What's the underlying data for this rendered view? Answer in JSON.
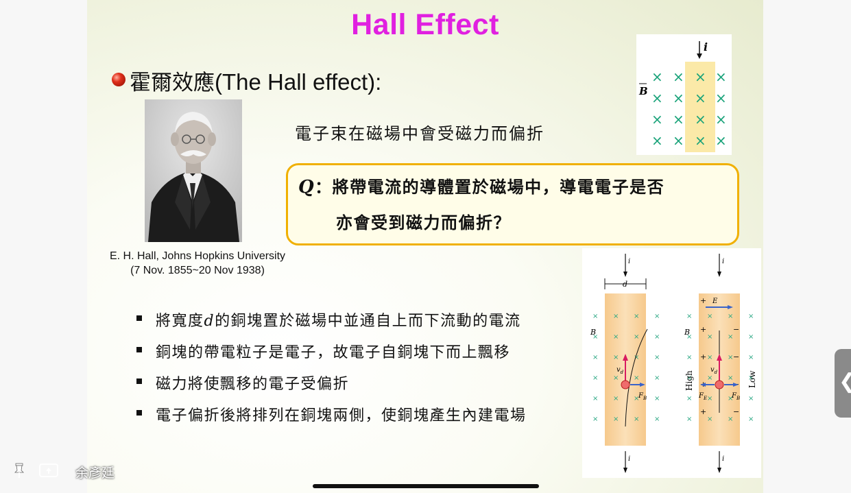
{
  "slide": {
    "title": "Hall Effect",
    "heading_zh": "霍爾效應",
    "heading_en": "(The Hall effect):",
    "portrait_caption_line1": "E. H. Hall, Johns Hopkins University",
    "portrait_caption_line2": "(7 Nov. 1855~20 Nov 1938)",
    "description": "電子束在磁場中會受磁力而偏折",
    "question": {
      "label": "Q",
      "colon": "：",
      "line1": "將帶電流的導體置於磁場中，導電電子是否",
      "line2": "亦會受到磁力而偏折？"
    },
    "bullets": [
      {
        "pre": "將寬度",
        "var": "d",
        "post": "的銅塊置於磁場中並通自上而下流動的電流"
      },
      {
        "text": "銅塊的帶電粒子是電子，故電子自銅塊下而上飄移"
      },
      {
        "text": "磁力將使飄移的電子受偏折"
      },
      {
        "text": "電子偏折後將排列在銅塊兩側，使銅塊產生內建電場"
      }
    ]
  },
  "figure_top": {
    "current_label": "i",
    "field_label": "B",
    "field_symbol": "×",
    "accent_color": "#1aa37a",
    "strip_color": "#fbe9a8"
  },
  "figure_bottom": {
    "current_label": "i",
    "width_label": "d",
    "field_label": "B",
    "velocity_label": "v",
    "velocity_sub": "d",
    "force_label": "F",
    "force_sub_B": "B",
    "force_sub_E": "E",
    "efield_label": "E",
    "high_label": "High",
    "low_label": "Low",
    "plus_sign": "+",
    "minus_sign": "−"
  },
  "footer": {
    "pin_icon": "pin-icon",
    "screen_icon": "screen-share-icon",
    "username": "余彥廷"
  },
  "side_tab": {
    "glyph": "❮"
  }
}
